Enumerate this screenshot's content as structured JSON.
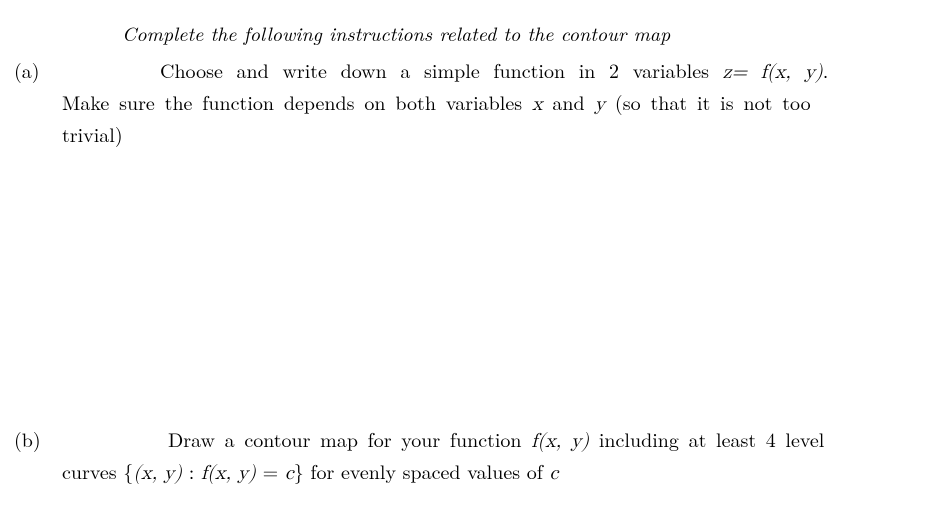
{
  "header": {
    "instruction": "Complete the following instructions related to the contour map"
  },
  "items": {
    "a": {
      "label": "(a)",
      "line1_pre": "Choose and write down a simple function in 2 variables ",
      "line1_math_z": "z",
      "line1_eq": "=",
      "line1_math_fxy": "f(x, y)",
      "line1_post": ".",
      "line2_pre": "Make sure the function depends on both variables ",
      "line2_math_x": "x",
      "line2_mid": " and ",
      "line2_math_y": "y",
      "line2_post": " (so that it is not too",
      "line3": "trivial)"
    },
    "b": {
      "label": "(b)",
      "line1_pre": "Draw a contour map for your function ",
      "line1_math_fxy": "f(x, y)",
      "line1_post": " including at least 4 level",
      "line2_pre": "curves ",
      "line2_math_set": "{(x, y) : f(x, y) = c}",
      "line2_mid": " for evenly spaced values of ",
      "line2_math_c": "c"
    }
  }
}
